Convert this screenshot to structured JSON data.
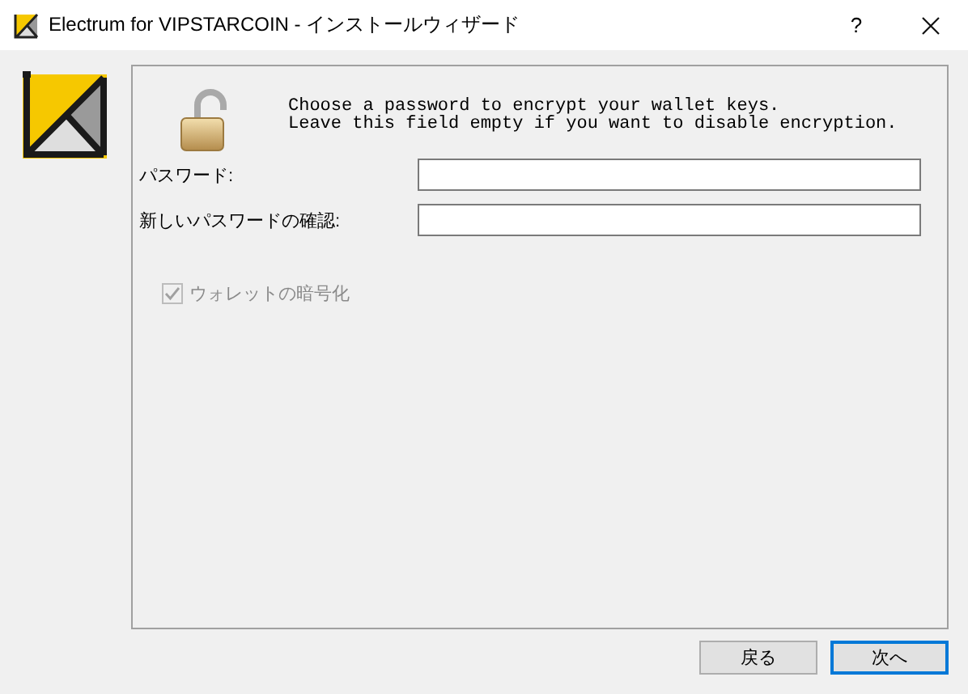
{
  "window": {
    "title": "Electrum for VIPSTARCOIN - インストールウィザード",
    "help": "?"
  },
  "message": [
    "Choose a password to encrypt your wallet keys.",
    "Leave this field empty if you want to disable encryption."
  ],
  "fields": [
    {
      "label": "パスワード:"
    },
    {
      "label": "新しいパスワードの確認:"
    }
  ],
  "checkbox": {
    "label": "ウォレットの暗号化",
    "checked": true,
    "disabled": true
  },
  "buttons": [
    {
      "label": "戻る",
      "default": false
    },
    {
      "label": "次へ",
      "default": true
    }
  ]
}
